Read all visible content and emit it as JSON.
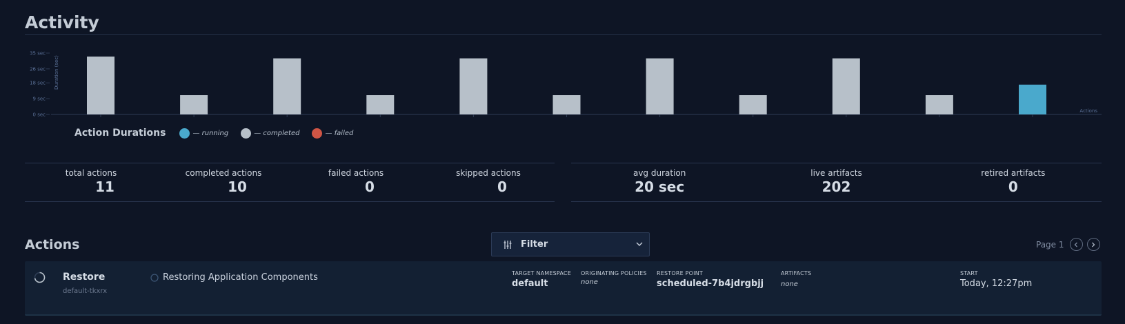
{
  "activity": {
    "title": "Activity"
  },
  "chart_data": {
    "type": "bar",
    "title": "Action Durations",
    "ylabel": "Duration (sec)",
    "xlabel": "Actions",
    "ylim": [
      0,
      36
    ],
    "yticks": [
      "0 sec",
      "9 sec",
      "18 sec",
      "26 sec",
      "35 sec"
    ],
    "ytick_values": [
      0,
      9,
      18,
      26,
      35
    ],
    "values": [
      33,
      11,
      32,
      11,
      32,
      11,
      32,
      11,
      32,
      11,
      17
    ],
    "status": [
      "completed",
      "completed",
      "completed",
      "completed",
      "completed",
      "completed",
      "completed",
      "completed",
      "completed",
      "completed",
      "running"
    ],
    "grid": false,
    "legend_position": "bottom-left",
    "legend": [
      {
        "label": "— running",
        "color": "#4aa9cc"
      },
      {
        "label": "— completed",
        "color": "#b7c0c9"
      },
      {
        "label": "— failed",
        "color": "#d05545"
      }
    ]
  },
  "stats": {
    "left": [
      {
        "label": "total actions",
        "value": "11"
      },
      {
        "label": "completed actions",
        "value": "10"
      },
      {
        "label": "failed actions",
        "value": "0"
      },
      {
        "label": "skipped actions",
        "value": "0"
      }
    ],
    "right": [
      {
        "label": "avg duration",
        "value": "20 sec"
      },
      {
        "label": "live artifacts",
        "value": "202"
      },
      {
        "label": "retired artifacts",
        "value": "0"
      }
    ]
  },
  "actions": {
    "title": "Actions",
    "filter_label": "Filter",
    "page_label": "Page 1",
    "items": [
      {
        "name": "Restore",
        "sub": "default-tkxrx",
        "phase": "Restoring Application Components",
        "target_namespace_h": "TARGET NAMESPACE",
        "target_namespace": "default",
        "originating_policies_h": "ORIGINATING POLICIES",
        "originating_policies": "none",
        "restore_point_h": "RESTORE POINT",
        "restore_point": "scheduled-7b4jdrgbjj",
        "artifacts_h": "ARTIFACTS",
        "artifacts": "none",
        "start_h": "START",
        "start": "Today, 12:27pm"
      }
    ]
  },
  "colors": {
    "background": "#0e1525",
    "bar_completed": "#b7c0c9",
    "bar_running": "#4aa9cc",
    "card": "#132033"
  }
}
